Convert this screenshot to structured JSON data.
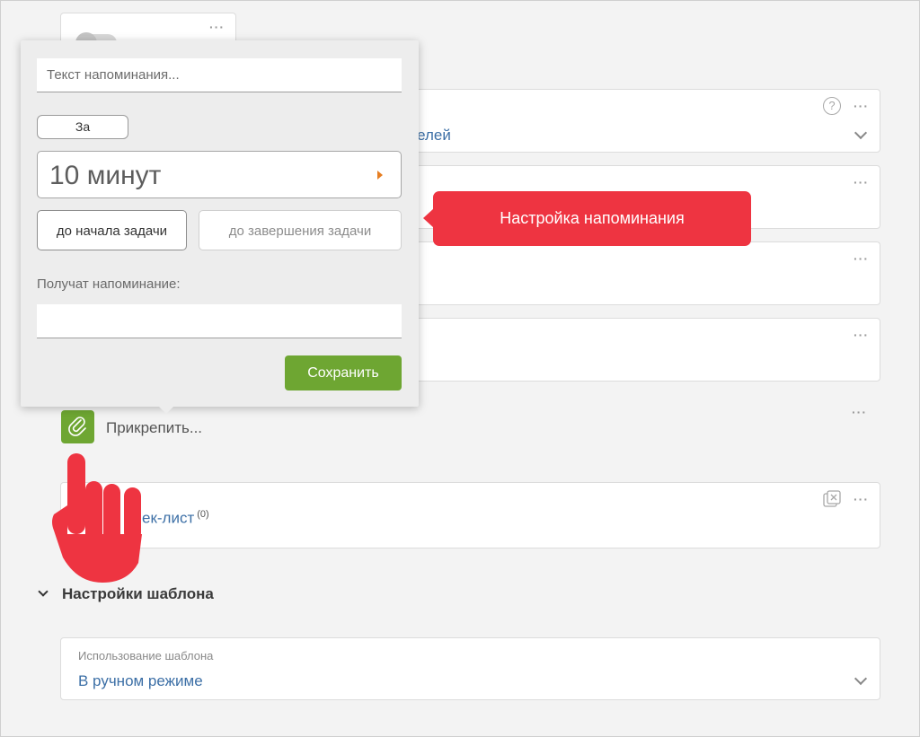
{
  "popup": {
    "reminder_placeholder": "Текст напоминания...",
    "za_label": "За",
    "time_value": "10 минут",
    "before_start_label": "до начала задачи",
    "before_end_label": "до завершения задачи",
    "recipients_label": "Получат напоминание:",
    "save_label": "Сохранить"
  },
  "callout": {
    "text": "Настройка напоминания"
  },
  "background": {
    "partial_link": "ителей",
    "attach_label": "Прикрепить...",
    "checklist_label": "ек-лист",
    "checklist_count": "(0)",
    "help_symbol": "?"
  },
  "template_settings": {
    "title": "Настройки шаблона",
    "usage_label": "Использование шаблона",
    "usage_value": "В ручном режиме"
  },
  "colors": {
    "accent_green": "#6ea632",
    "callout_red": "#ee3441",
    "link_blue": "#3c6fa6"
  },
  "icons": [
    "toggle-icon",
    "help-icon",
    "more-dots-icon",
    "chevron-down-icon",
    "paperclip-icon",
    "clear-checklist-icon",
    "pointing-hand-icon"
  ]
}
